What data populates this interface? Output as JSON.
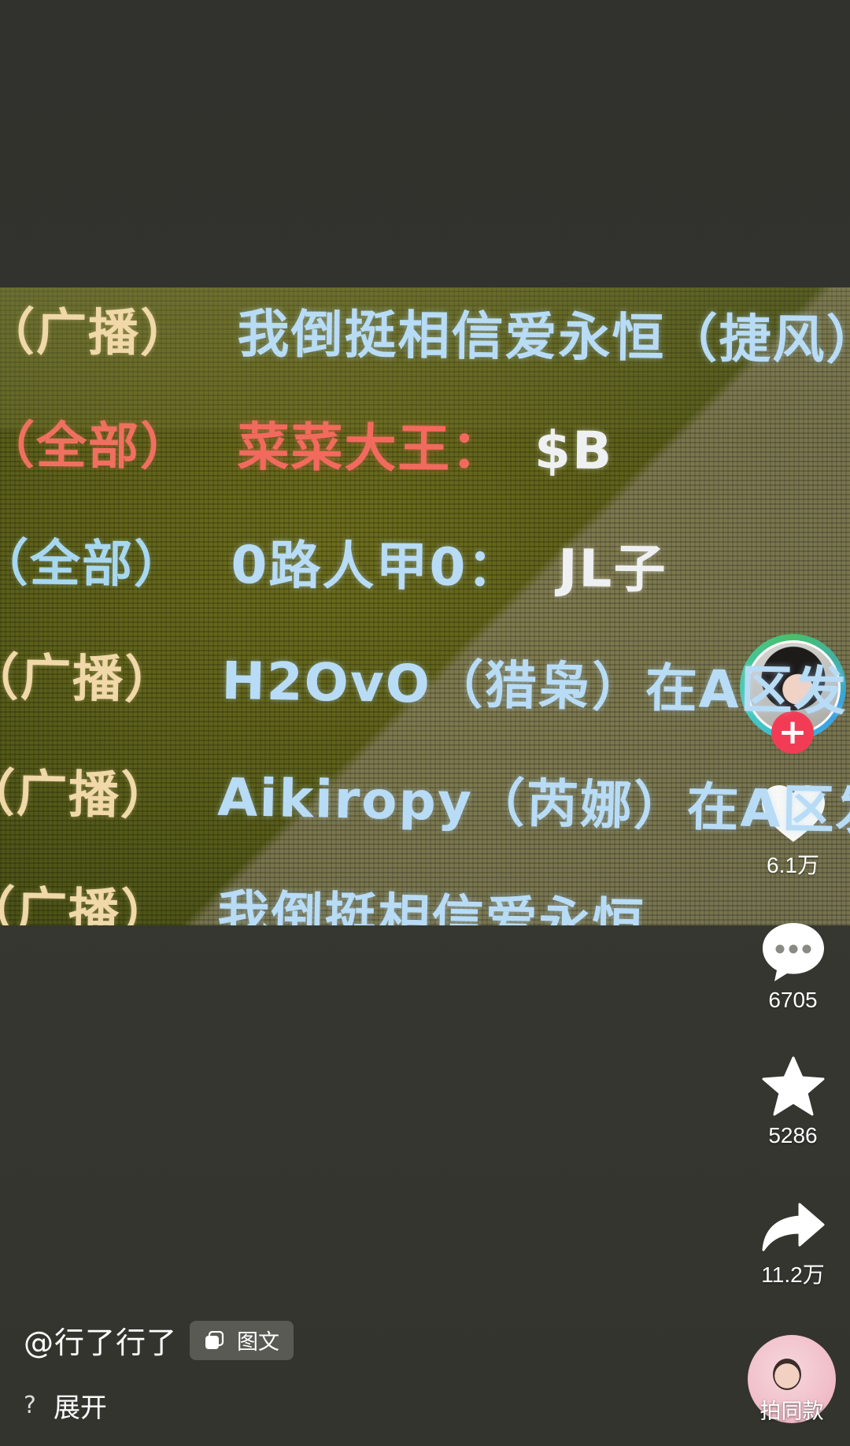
{
  "post": {
    "photo": {
      "lines": [
        {
          "channel": "（广播）",
          "message": "我倒挺相信爱永恒（捷风）",
          "channel_color": "#f0d8a8",
          "message_color": "#b8dcf6"
        },
        {
          "channel": "（全部）",
          "message": "菜菜大王：",
          "message_tail": "$B",
          "channel_color": "#f07060",
          "message_color": "#f26a5e",
          "tail_color": "#eef0f2"
        },
        {
          "channel": "（全部）",
          "message": "0路人甲0：",
          "message_tail": "JL子",
          "channel_color": "#a8d8f0",
          "message_color": "#b8dcf6",
          "tail_color": "#eef0f2"
        },
        {
          "channel": "（广播）",
          "message": "H2OvO（猎枭）在A区发",
          "channel_color": "#f0d8a8",
          "message_color": "#b8dcf6"
        },
        {
          "channel": "（广播）",
          "message": "Aikiropy（芮娜）在A区发现",
          "channel_color": "#f0d8a8",
          "message_color": "#b8dcf6"
        },
        {
          "channel": "（广播）",
          "message": "我倒挺相信爱永恒",
          "channel_color": "#f0d8a8",
          "message_color": "#b8dcf6"
        }
      ]
    },
    "author": "@行了行了",
    "tag": {
      "icon": "image-text-icon",
      "label": "图文"
    },
    "expand": {
      "icon": "?",
      "label": "展开"
    }
  },
  "actions": {
    "follow_icon": "+",
    "like": {
      "icon": "heart-icon",
      "count": "6.1万"
    },
    "comment": {
      "icon": "comment-bubble-icon",
      "count": "6705"
    },
    "favorite": {
      "icon": "star-icon",
      "count": "5286"
    },
    "share": {
      "icon": "share-arrow-icon",
      "count": "11.2万"
    },
    "music_label": "拍同款"
  },
  "colors": {
    "follow": "#f23c55",
    "avatar_ring": "#3aa0e6"
  }
}
